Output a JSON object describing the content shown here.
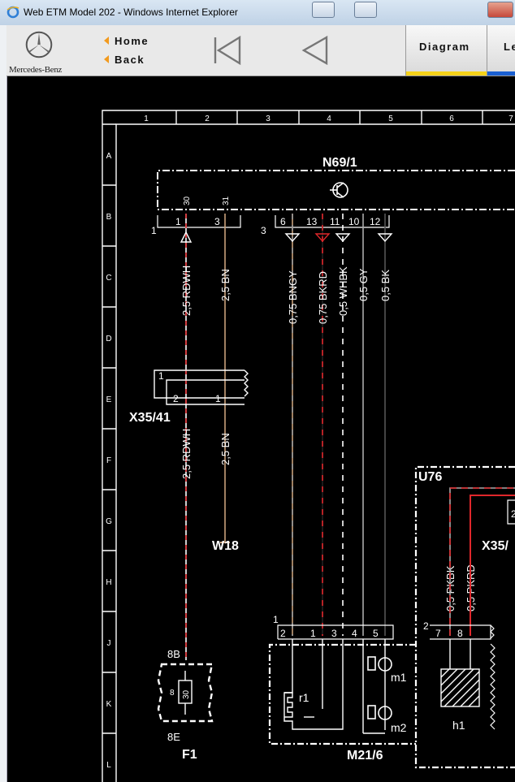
{
  "window": {
    "title": "Web ETM Model 202 - Windows Internet Explorer"
  },
  "brand": {
    "name": "Mercedes-Benz"
  },
  "nav": {
    "home_label": "Home",
    "back_label": "Back"
  },
  "tabs": [
    {
      "label": "Diagram",
      "accent": "#f5d21a"
    },
    {
      "label": "Le",
      "accent": "#1a5fd1"
    }
  ],
  "grid": {
    "columns": [
      "1",
      "2",
      "3",
      "4",
      "5",
      "6",
      "7"
    ],
    "rows": [
      "A",
      "B",
      "C",
      "D",
      "E",
      "F",
      "G",
      "H",
      "J",
      "K",
      "L"
    ]
  },
  "components": {
    "n69": "N69/1",
    "x3541": "X35/41",
    "w18": "W18",
    "u76": "U76",
    "x35b": "X35/",
    "f1": "F1",
    "m216": "M21/6",
    "m1": "m1",
    "m2": "m2",
    "r1": "r1",
    "h1": "h1",
    "f1_top": "8B",
    "f1_bottom": "8E",
    "f1_fuse": "8",
    "f1_fuse_val": "30"
  },
  "wires": [
    {
      "label": "2,5 RDWH"
    },
    {
      "label": "2,5 BN"
    },
    {
      "label": "0,75 BNGY"
    },
    {
      "label": "0,75 BKRD"
    },
    {
      "label": "0,5 WHBK"
    },
    {
      "label": "0,5 GY"
    },
    {
      "label": "0,5 BK"
    },
    {
      "label": "2,5 RDWH"
    },
    {
      "label": "2,5 BN"
    },
    {
      "label": "0,5 PKBK"
    },
    {
      "label": "0,5 PKRD"
    }
  ],
  "pins": {
    "n69_1": "1",
    "n69_30": "30",
    "n69_3": "3",
    "n69_31": "31",
    "n69_6": "6",
    "n69_13": "13",
    "n69_11": "11",
    "n69_10": "10",
    "n69_12": "12",
    "conn1": "1",
    "conn3": "3",
    "x_1": "1",
    "x_2": "2",
    "x_1b": "1",
    "m_1": "1",
    "m_2": "2",
    "m_1b": "1",
    "m_3": "3",
    "m_4": "4",
    "m_5": "5",
    "u_2": "2",
    "u_7": "7",
    "u_8": "8",
    "u_2b": "2"
  },
  "colors": {
    "frame": "#ffffff",
    "red": "#e0272b",
    "brown": "#c9a07a"
  }
}
